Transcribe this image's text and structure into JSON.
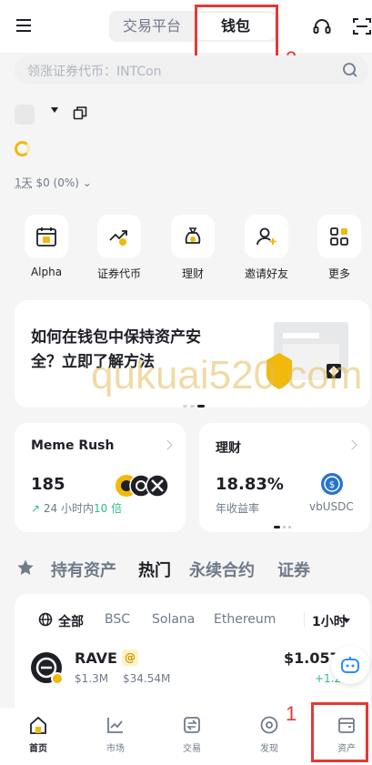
{
  "header": {
    "tabs": [
      {
        "label": "交易平台"
      },
      {
        "label": "钱包"
      }
    ],
    "menu_icon": "hamburger-icon",
    "support_icon": "headset-icon",
    "scan_icon": "scan-icon"
  },
  "search": {
    "placeholder": "领涨证券代币：INTCon"
  },
  "account": {
    "pnl_period": "1天",
    "pnl_value": "$0 (0%)"
  },
  "shortcuts": [
    {
      "label": "Alpha",
      "icon": "alpha-calendar-icon"
    },
    {
      "label": "证券代币",
      "icon": "stock-token-icon"
    },
    {
      "label": "理财",
      "icon": "money-bag-icon"
    },
    {
      "label": "邀请好友",
      "icon": "invite-friend-icon"
    },
    {
      "label": "更多",
      "icon": "more-grid-icon"
    }
  ],
  "banner": {
    "title": "如何在钱包中保持资产安全？立即了解方法"
  },
  "watermark": "qukuai520.com",
  "cards": {
    "meme": {
      "title": "Meme Rush",
      "value": "185",
      "sub_prefix": "24 小时内",
      "sub_highlight": "10 倍"
    },
    "earn": {
      "title": "理财",
      "value": "18.83%",
      "sub": "年收益率",
      "asset": "vbUSDC"
    }
  },
  "market_tabs": [
    "持有资产",
    "热门",
    "永续合约",
    "证券"
  ],
  "active_market_tab": "热门",
  "chains": [
    "全部",
    "BSC",
    "Solana",
    "Ethereum"
  ],
  "period": "1小时",
  "tokens": [
    {
      "name": "RAVE",
      "mcap": "$1.3M",
      "volume": "$34.54M",
      "price": "$1.057",
      "change": "+1.2"
    }
  ],
  "nav": [
    {
      "label": "首页",
      "icon": "home-icon",
      "active": true
    },
    {
      "label": "市场",
      "icon": "chart-icon",
      "active": false
    },
    {
      "label": "交易",
      "icon": "trade-icon",
      "active": false
    },
    {
      "label": "发现",
      "icon": "discover-icon",
      "active": false
    },
    {
      "label": "资产",
      "icon": "wallet-icon",
      "active": false
    }
  ],
  "annotations": [
    "1",
    "2"
  ],
  "colors": {
    "accent": "#f0b90b",
    "text": "#1e2026",
    "muted": "#707a8a",
    "positive": "#2ebd85",
    "annotation": "#e53935"
  }
}
